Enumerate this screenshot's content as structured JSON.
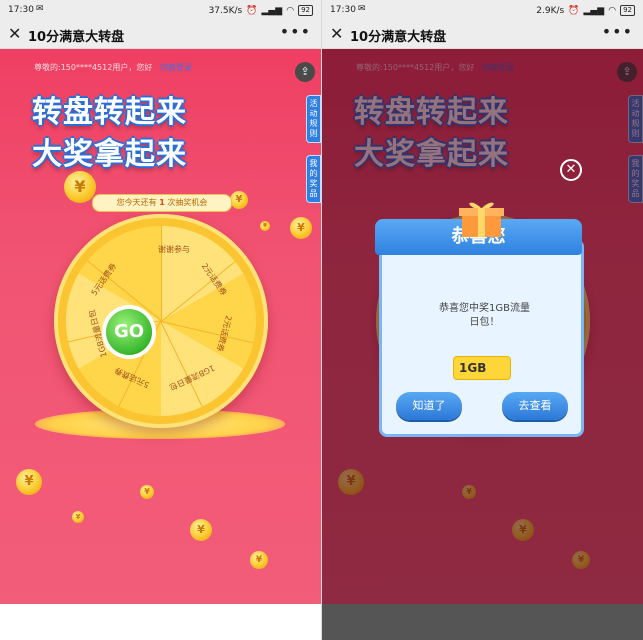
{
  "status_bar_left": {
    "time": "17:30",
    "mail_icon": "✉",
    "speed": "37.5K/s",
    "battery": "92"
  },
  "status_bar_right": {
    "time": "17:30",
    "mail_icon": "✉",
    "speed": "2.9K/s",
    "battery": "92"
  },
  "navbar": {
    "close": "✕",
    "title": "10分满意大转盘",
    "more": "•••"
  },
  "page": {
    "user_greeting": "尊敬的:150****4512用户，您好",
    "switch_login": "切换登录",
    "share_icon": "⇪",
    "side_tab_rules": "活动规则",
    "side_tab_prizes": "我的奖品",
    "headline_line1": "转盘转起来",
    "headline_line2": "大奖拿起来",
    "chance_prefix": "您今天还有",
    "chance_count": "1",
    "chance_suffix": "次抽奖机会",
    "go_label": "GO"
  },
  "wheel_prizes": [
    "谢谢参与",
    "2元话费券",
    "2元话费券",
    "1GB流量日包",
    "5元话费券",
    "1GB流量日包",
    "5元话费券"
  ],
  "coin_glyph": "¥",
  "modal": {
    "title": "恭喜您",
    "message_line1": "恭喜您中奖1GB流量",
    "message_line2": "日包！",
    "ticket_label": "1GB",
    "btn_ok": "知道了",
    "btn_view": "去查看",
    "close_icon": "✕"
  }
}
